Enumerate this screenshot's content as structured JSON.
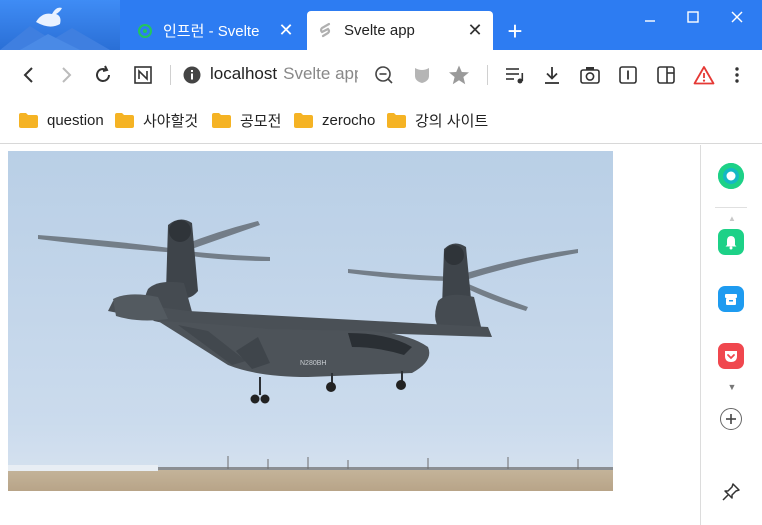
{
  "tabs": [
    {
      "title": "인프런 - Svelte",
      "favicon": "inflearn-icon",
      "state": "inactive"
    },
    {
      "title": "Svelte app",
      "favicon": "svelte-icon",
      "state": "active"
    }
  ],
  "address_bar": {
    "host": "localhost",
    "page_title": "Svelte app"
  },
  "bookmarks": [
    {
      "label": "question"
    },
    {
      "label": "사야할것"
    },
    {
      "label": "공모전"
    },
    {
      "label": "zerocho"
    },
    {
      "label": "강의 사이트"
    }
  ],
  "content": {
    "image_subject": "tiltrotor aircraft N280BH hovering over a runway"
  },
  "colors": {
    "tabbar": "#2d7cf2",
    "accent_green": "#1dd187",
    "accent_blue": "#1e9bf0",
    "accent_red": "#f0474e",
    "warning": "#e53935"
  }
}
